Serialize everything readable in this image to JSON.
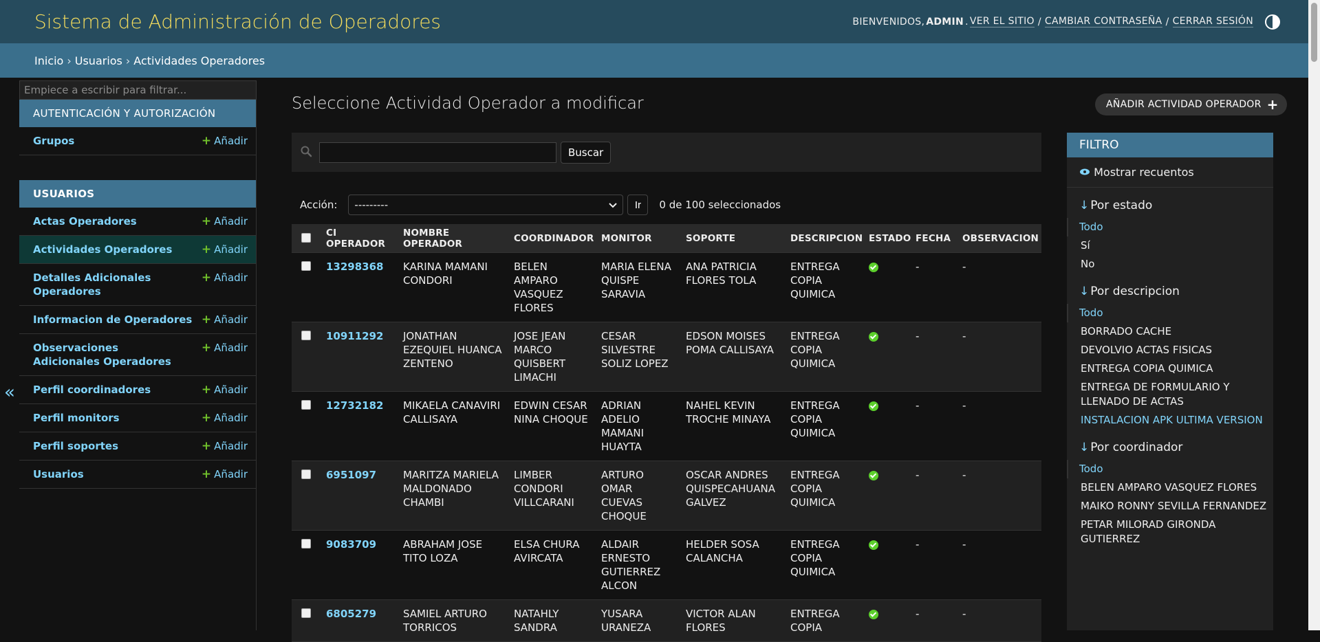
{
  "header": {
    "site_title": "Sistema de Administración de Operadores",
    "welcome": "BIENVENIDOS,",
    "username": "ADMIN",
    "view_site": "VER EL SITIO",
    "change_password": "CAMBIAR CONTRASEÑA",
    "logout": "CERRAR SESIÓN",
    "separator": "/"
  },
  "breadcrumbs": {
    "home": "Inicio",
    "app": "Usuarios",
    "current": "Actividades Operadores",
    "sep": "›"
  },
  "sidebar": {
    "filter_placeholder": "Empiece a escribir para filtrar...",
    "add_label": "Añadir",
    "auth_module": {
      "caption": "AUTENTICACIÓN Y AUTORIZACIÓN",
      "items": [
        {
          "label": "Grupos"
        }
      ]
    },
    "users_module": {
      "caption": "USUARIOS",
      "items": [
        {
          "label": "Actas Operadores"
        },
        {
          "label": "Actividades Operadores",
          "current": true
        },
        {
          "label": "Detalles Adicionales Operadores"
        },
        {
          "label": "Informacion de Operadores"
        },
        {
          "label": "Observaciones Adicionales Operadores"
        },
        {
          "label": "Perfil coordinadores"
        },
        {
          "label": "Perfil monitors"
        },
        {
          "label": "Perfil soportes"
        },
        {
          "label": "Usuarios"
        }
      ]
    },
    "toggle_glyph": "«"
  },
  "content": {
    "title": "Seleccione Actividad Operador a modificar",
    "add_button": "AÑADIR ACTIVIDAD OPERADOR",
    "search_button": "Buscar",
    "search_value": "",
    "action_label": "Acción:",
    "action_selected": "---------",
    "go_button": "Ir",
    "selection_count": "0 de 100 seleccionados"
  },
  "table": {
    "columns": [
      "CI OPERADOR",
      "NOMBRE OPERADOR",
      "COORDINADOR",
      "MONITOR",
      "SOPORTE",
      "DESCRIPCION",
      "ESTADO",
      "FECHA",
      "OBSERVACION"
    ],
    "rows": [
      {
        "ci": "13298368",
        "nombre": "KARINA MAMANI CONDORI",
        "coordinador": "BELEN AMPARO VASQUEZ FLORES",
        "monitor": "MARIA ELENA QUISPE SARAVIA",
        "soporte": "ANA PATRICIA FLORES TOLA",
        "descripcion": "ENTREGA COPIA QUIMICA",
        "estado": "check-icon",
        "fecha": "-",
        "observacion": "-"
      },
      {
        "ci": "10911292",
        "nombre": "JONATHAN EZEQUIEL HUANCA ZENTENO",
        "coordinador": "JOSE JEAN MARCO QUISBERT LIMACHI",
        "monitor": "CESAR SILVESTRE SOLIZ LOPEZ",
        "soporte": "EDSON MOISES POMA CALLISAYA",
        "descripcion": "ENTREGA COPIA QUIMICA",
        "estado": "check-icon",
        "fecha": "-",
        "observacion": "-"
      },
      {
        "ci": "12732182",
        "nombre": "MIKAELA CANAVIRI CALLISAYA",
        "coordinador": "EDWIN CESAR NINA CHOQUE",
        "monitor": "ADRIAN ADELIO MAMANI HUAYTA",
        "soporte": "NAHEL KEVIN TROCHE MINAYA",
        "descripcion": "ENTREGA COPIA QUIMICA",
        "estado": "check-icon",
        "fecha": "-",
        "observacion": "-"
      },
      {
        "ci": "6951097",
        "nombre": "MARITZA MARIELA MALDONADO CHAMBI",
        "coordinador": "LIMBER CONDORI VILLCARANI",
        "monitor": "ARTURO OMAR CUEVAS CHOQUE",
        "soporte": "OSCAR ANDRES QUISPECAHUANA GALVEZ",
        "descripcion": "ENTREGA COPIA QUIMICA",
        "estado": "check-icon",
        "fecha": "-",
        "observacion": "-"
      },
      {
        "ci": "9083709",
        "nombre": "ABRAHAM JOSE TITO LOZA",
        "coordinador": "ELSA CHURA AVIRCATA",
        "monitor": "ALDAIR ERNESTO GUTIERREZ ALCON",
        "soporte": "HELDER SOSA CALANCHA",
        "descripcion": "ENTREGA COPIA QUIMICA",
        "estado": "check-icon",
        "fecha": "-",
        "observacion": "-"
      },
      {
        "ci": "6805279",
        "nombre": "SAMIEL ARTURO TORRICOS",
        "coordinador": "NATAHLY SANDRA",
        "monitor": "YUSARA URANEZA",
        "soporte": "VICTOR ALAN FLORES",
        "descripcion": "ENTREGA COPIA",
        "estado": "check-icon",
        "fecha": "-",
        "observacion": "-"
      }
    ]
  },
  "filter": {
    "title": "FILTRO",
    "show_counts": "Mostrar recuentos",
    "sections": [
      {
        "heading": "Por estado",
        "items": [
          "Todo",
          "Sí",
          "No"
        ]
      },
      {
        "heading": "Por descripcion",
        "items": [
          "Todo",
          "BORRADO CACHE",
          "DEVOLVIO ACTAS FISICAS",
          "ENTREGA COPIA QUIMICA",
          "ENTREGA DE FORMULARIO Y LLENADO DE ACTAS",
          "INSTALACION APK ULTIMA VERSION"
        ]
      },
      {
        "heading": "Por coordinador",
        "items": [
          "Todo",
          "BELEN AMPARO VASQUEZ FLORES",
          "MAIKO RONNY SEVILLA FERNANDEZ",
          "PETAR MILORAD GIRONDA GUTIERREZ"
        ]
      }
    ]
  },
  "colors": {
    "header_bg": "#264b5d",
    "title_yellow": "#f5dd5d",
    "breadcrumb_bg": "#3a6f8c",
    "link": "#81d4fa",
    "add_green": "#70bf2b",
    "status_green": "#5ccf2c"
  }
}
